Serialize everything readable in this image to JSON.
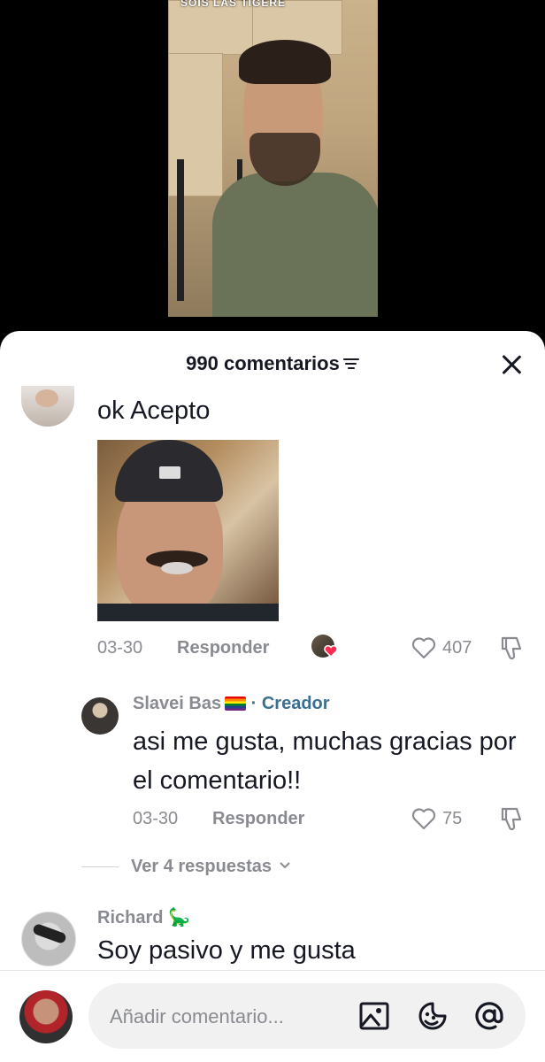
{
  "video": {
    "overlay_text": "SOIS LAS TIGERE"
  },
  "sheet": {
    "comment_count": "990 comentarios"
  },
  "comments": [
    {
      "text": "ok Acepto",
      "date": "03-30",
      "reply_label": "Responder",
      "likes": "407",
      "replies": [
        {
          "author": "Slavei Bas",
          "creator_label": "· Creador",
          "text": "asi me gusta, muchas gracias por el comentario!!",
          "date": "03-30",
          "reply_label": "Responder",
          "likes": "75"
        }
      ],
      "view_replies_label": "Ver 4 respuestas"
    },
    {
      "author": "Richard 🦕",
      "text": "Soy pasivo y me gusta"
    }
  ],
  "composer": {
    "placeholder": "Añadir comentario..."
  },
  "colors": {
    "text": "#161823",
    "muted": "#8a8b91",
    "creator": "#3b6f8f",
    "heart_badge": "#fe2c55"
  }
}
